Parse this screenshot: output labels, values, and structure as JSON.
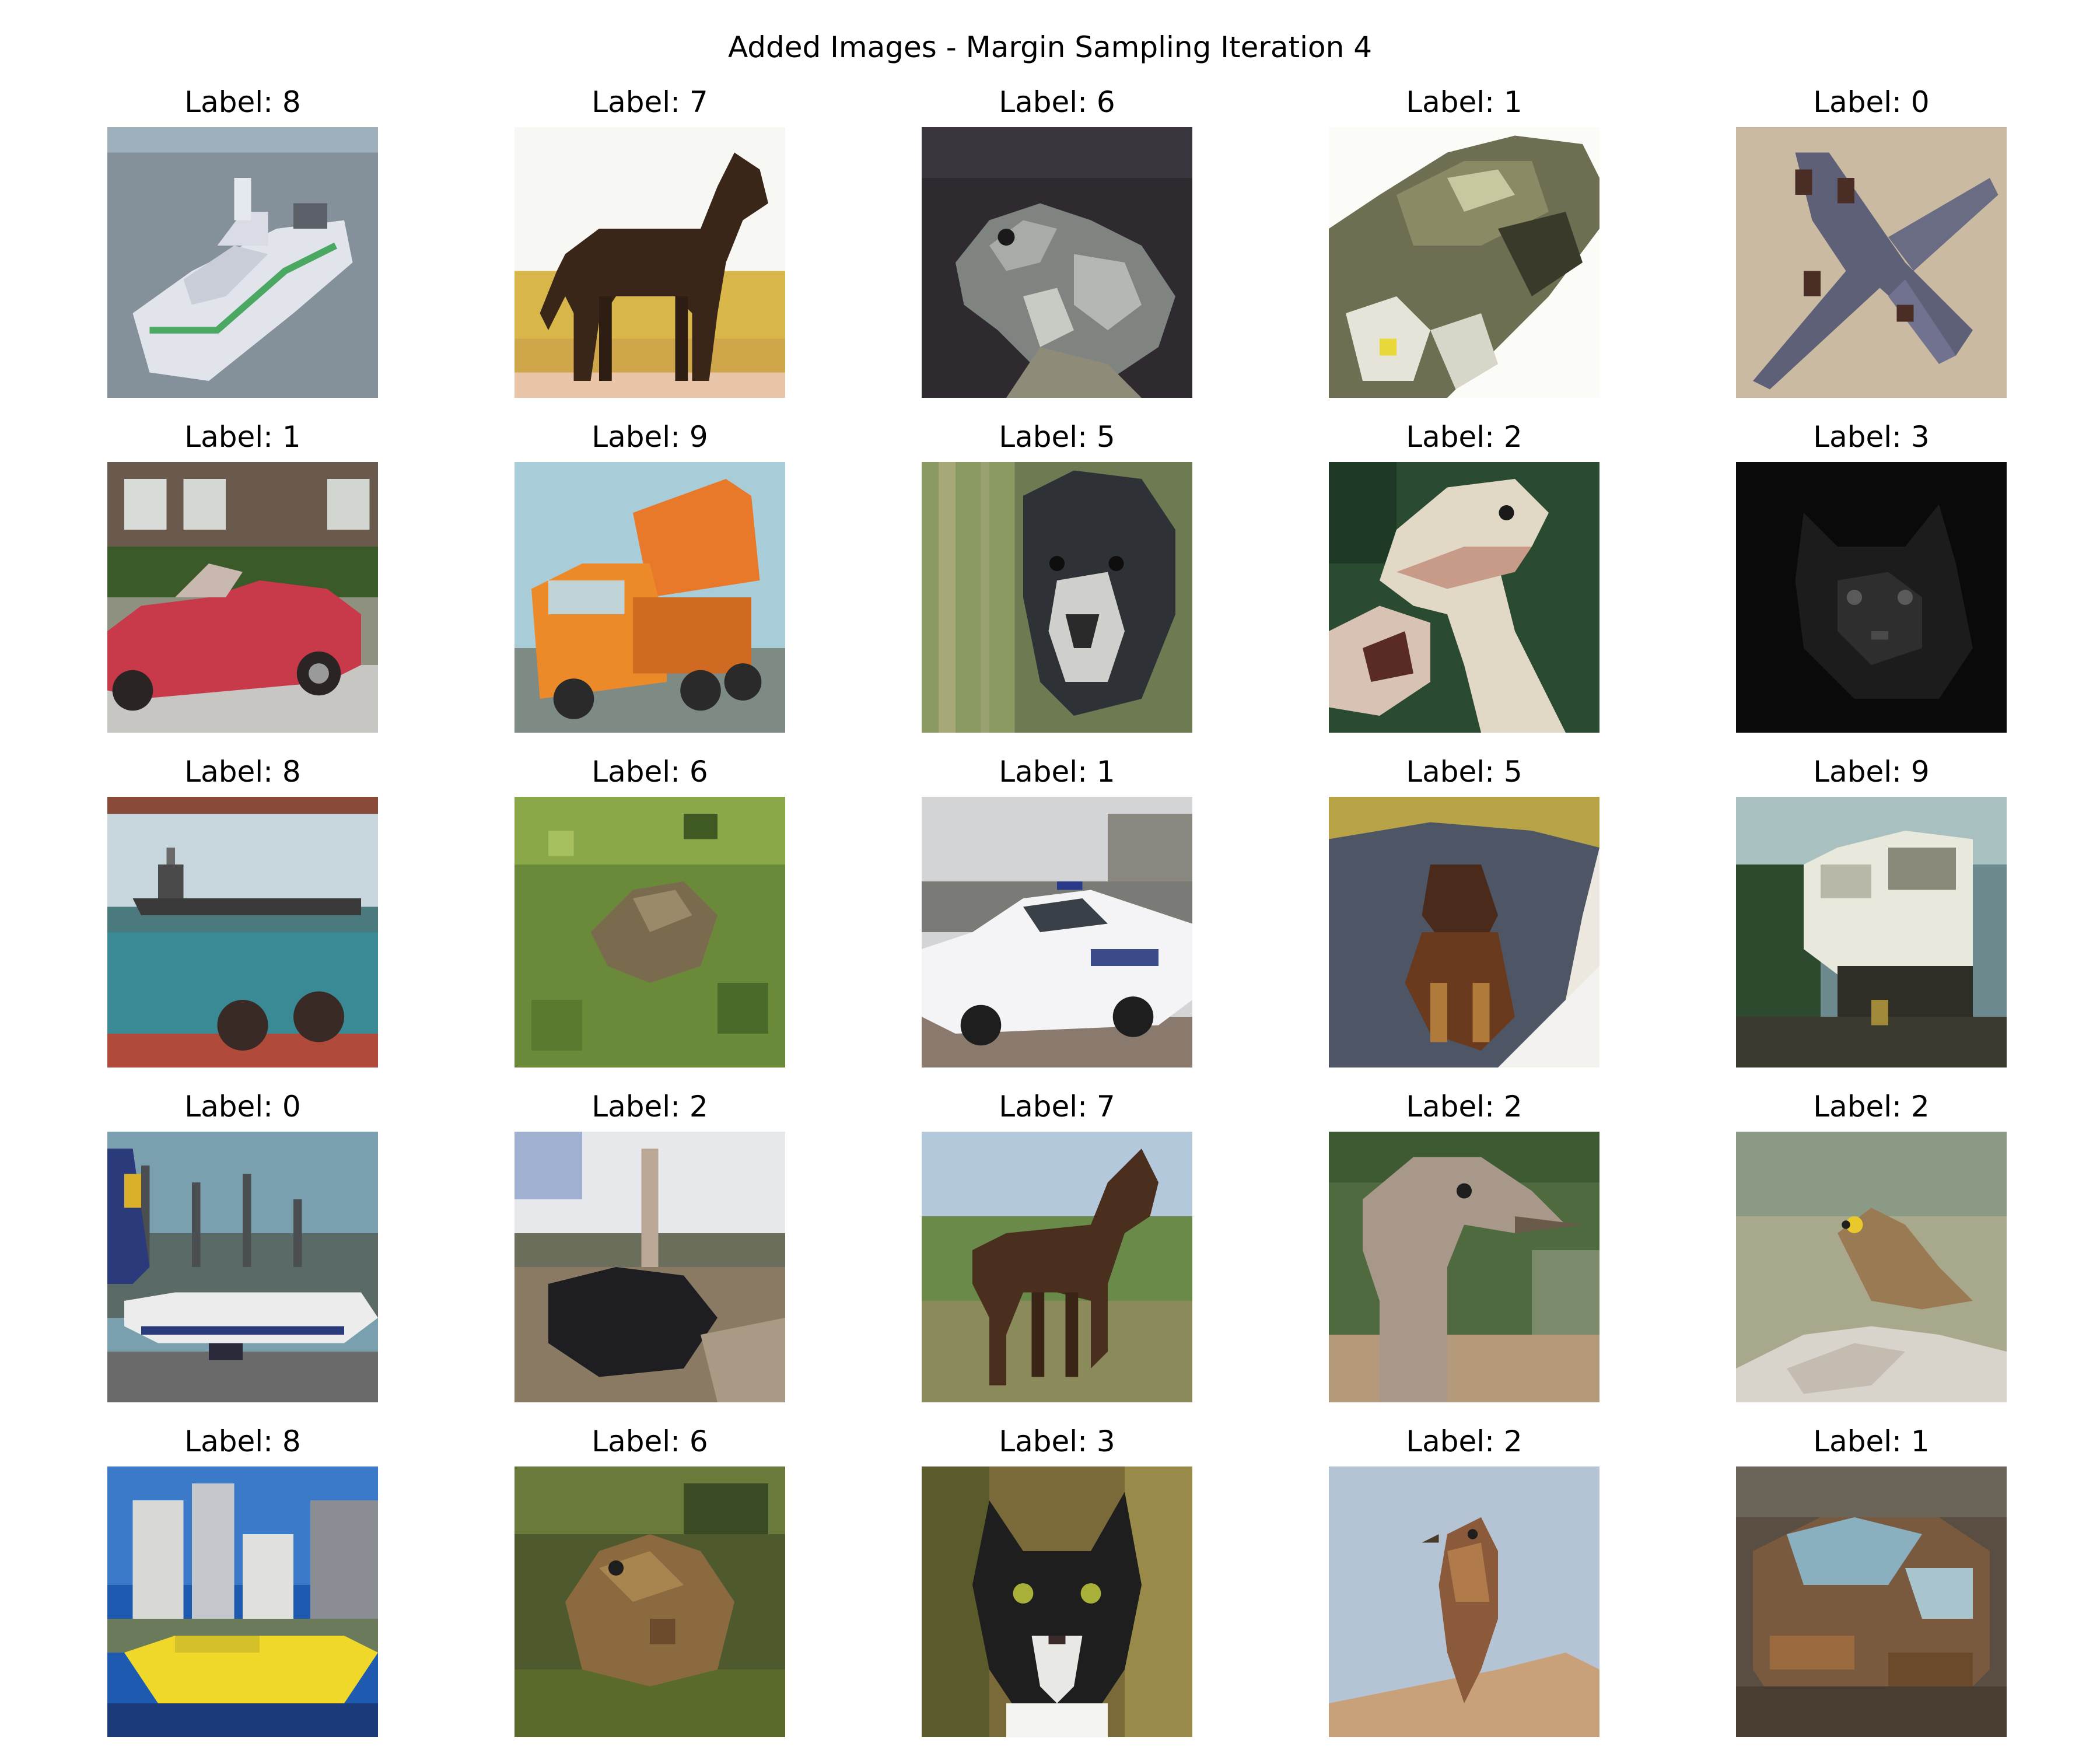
{
  "figure": {
    "title": "Added Images - Margin Sampling Iteration 4"
  },
  "grid": {
    "rows": [
      {
        "cells": [
          {
            "label": "Label: 8",
            "subject": "white boat on water"
          },
          {
            "label": "Label: 7",
            "subject": "dark brown horse on yellow field"
          },
          {
            "label": "Label: 6",
            "subject": "grey frog on dark background"
          },
          {
            "label": "Label: 1",
            "subject": "car close-up on white background"
          },
          {
            "label": "Label: 0",
            "subject": "airplane seen from above"
          }
        ]
      },
      {
        "cells": [
          {
            "label": "Label: 1",
            "subject": "red convertible car"
          },
          {
            "label": "Label: 9",
            "subject": "orange dump truck"
          },
          {
            "label": "Label: 5",
            "subject": "black and white dog in grass"
          },
          {
            "label": "Label: 2",
            "subject": "ostrich head close-up"
          },
          {
            "label": "Label: 3",
            "subject": "dark cat face"
          }
        ]
      },
      {
        "cells": [
          {
            "label": "Label: 8",
            "subject": "ship on sea"
          },
          {
            "label": "Label: 6",
            "subject": "frog in green grass"
          },
          {
            "label": "Label: 1",
            "subject": "white police car"
          },
          {
            "label": "Label: 5",
            "subject": "small dog on grey blanket"
          },
          {
            "label": "Label: 9",
            "subject": "white truck in trees"
          }
        ]
      },
      {
        "cells": [
          {
            "label": "Label: 0",
            "subject": "airliner on tarmac"
          },
          {
            "label": "Label: 2",
            "subject": "ostrich in field"
          },
          {
            "label": "Label: 7",
            "subject": "brown horse on green field"
          },
          {
            "label": "Label: 2",
            "subject": "ostrich head close-up"
          },
          {
            "label": "Label: 2",
            "subject": "small bird on rock"
          }
        ]
      },
      {
        "cells": [
          {
            "label": "Label: 8",
            "subject": "yellow boat in front of city"
          },
          {
            "label": "Label: 6",
            "subject": "brown frog in grass"
          },
          {
            "label": "Label: 3",
            "subject": "black and white cat"
          },
          {
            "label": "Label: 2",
            "subject": "bird perched on branch"
          },
          {
            "label": "Label: 1",
            "subject": "old rusty car"
          }
        ]
      }
    ]
  }
}
